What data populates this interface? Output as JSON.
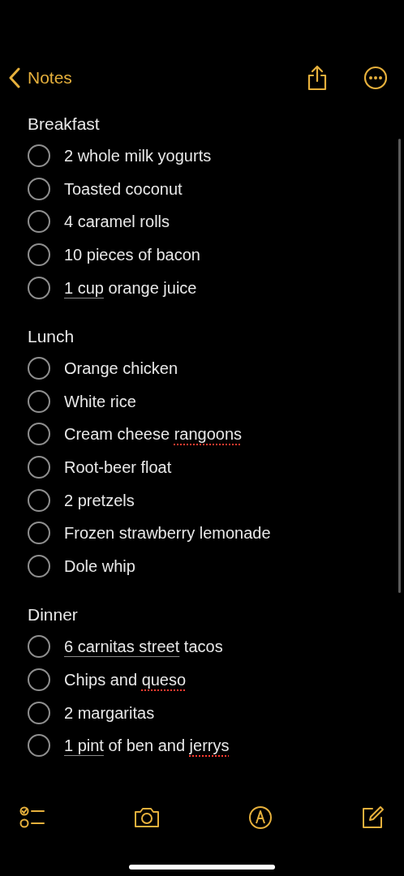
{
  "nav": {
    "back_label": "Notes"
  },
  "sections": [
    {
      "title": "Breakfast",
      "items": [
        {
          "checked": false,
          "parts": [
            {
              "text": "2 whole milk yogurts",
              "kind": "plain"
            }
          ]
        },
        {
          "checked": false,
          "parts": [
            {
              "text": "Toasted coconut",
              "kind": "plain"
            }
          ]
        },
        {
          "checked": false,
          "parts": [
            {
              "text": "4 caramel rolls",
              "kind": "plain"
            }
          ]
        },
        {
          "checked": false,
          "parts": [
            {
              "text": "10 pieces of bacon",
              "kind": "plain"
            }
          ]
        },
        {
          "checked": false,
          "parts": [
            {
              "text": "1 cup",
              "kind": "detected"
            },
            {
              "text": " orange juice",
              "kind": "plain"
            }
          ]
        }
      ]
    },
    {
      "title": "Lunch",
      "items": [
        {
          "checked": false,
          "parts": [
            {
              "text": "Orange chicken",
              "kind": "plain"
            }
          ]
        },
        {
          "checked": false,
          "parts": [
            {
              "text": "White rice",
              "kind": "plain"
            }
          ]
        },
        {
          "checked": false,
          "parts": [
            {
              "text": "Cream cheese ",
              "kind": "plain"
            },
            {
              "text": "rangoons",
              "kind": "misspelled"
            }
          ]
        },
        {
          "checked": false,
          "parts": [
            {
              "text": "Root-beer float",
              "kind": "plain"
            }
          ]
        },
        {
          "checked": false,
          "parts": [
            {
              "text": "2 pretzels",
              "kind": "plain"
            }
          ]
        },
        {
          "checked": false,
          "parts": [
            {
              "text": "Frozen strawberry lemonade",
              "kind": "plain"
            }
          ]
        },
        {
          "checked": false,
          "parts": [
            {
              "text": "Dole whip",
              "kind": "plain"
            }
          ]
        }
      ]
    },
    {
      "title": "Dinner",
      "items": [
        {
          "checked": false,
          "parts": [
            {
              "text": "6 carnitas street",
              "kind": "detected"
            },
            {
              "text": " tacos",
              "kind": "plain"
            }
          ]
        },
        {
          "checked": false,
          "parts": [
            {
              "text": "Chips and ",
              "kind": "plain"
            },
            {
              "text": "queso",
              "kind": "misspelled"
            }
          ]
        },
        {
          "checked": false,
          "parts": [
            {
              "text": "2 margaritas",
              "kind": "plain"
            }
          ]
        },
        {
          "checked": false,
          "parts": [
            {
              "text": "1 pint",
              "kind": "detected"
            },
            {
              "text": " of ben and ",
              "kind": "plain"
            },
            {
              "text": "jerrys",
              "kind": "misspelled"
            }
          ]
        }
      ]
    }
  ]
}
